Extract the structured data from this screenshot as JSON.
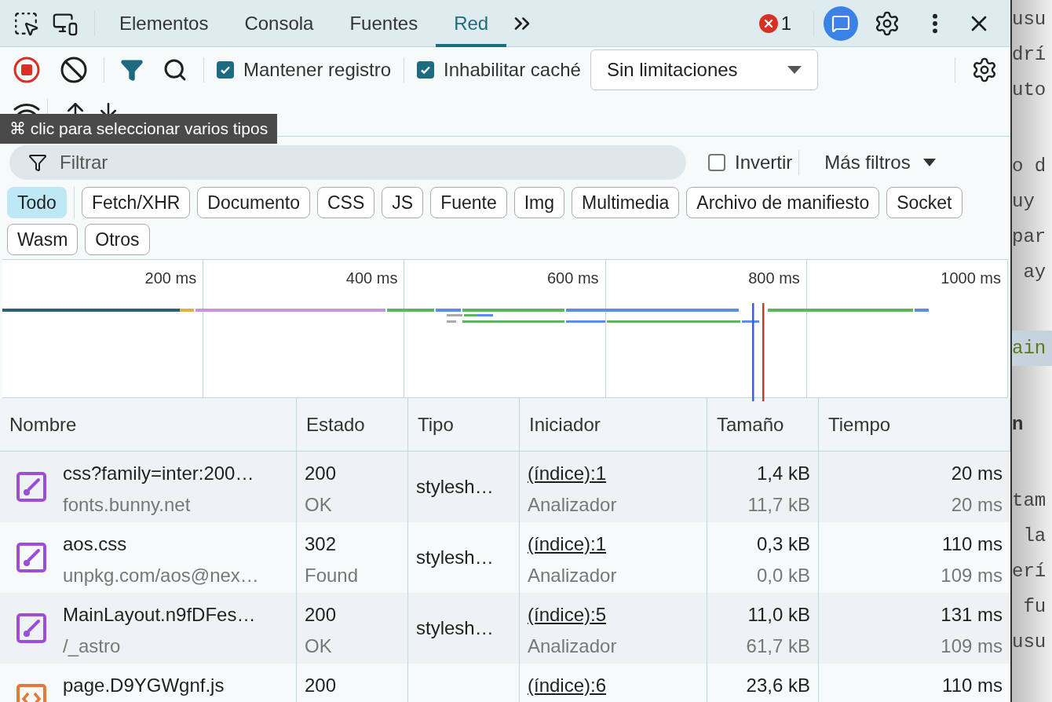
{
  "tabs": [
    {
      "label": "Elementos",
      "selected": false
    },
    {
      "label": "Consola",
      "selected": false
    },
    {
      "label": "Fuentes",
      "selected": false
    },
    {
      "label": "Red",
      "selected": true
    }
  ],
  "error_count": "1",
  "toolbar": {
    "recording": true,
    "checkboxes": [
      {
        "label": "Mantener registro",
        "checked": true
      },
      {
        "label": "Inhabilitar caché",
        "checked": true
      }
    ],
    "throttling": "Sin limitaciones"
  },
  "tooltip": "⌘ clic para seleccionar varios tipos",
  "filter": {
    "placeholder": "Filtrar",
    "invert": {
      "label": "Invertir",
      "checked": false
    },
    "more_filters": "Más filtros"
  },
  "type_filters": [
    {
      "label": "Todo",
      "selected": true
    },
    {
      "label": "Fetch/XHR",
      "selected": false
    },
    {
      "label": "Documento",
      "selected": false
    },
    {
      "label": "CSS",
      "selected": false
    },
    {
      "label": "JS",
      "selected": false
    },
    {
      "label": "Fuente",
      "selected": false
    },
    {
      "label": "Img",
      "selected": false
    },
    {
      "label": "Multimedia",
      "selected": false
    },
    {
      "label": "Archivo de manifiesto",
      "selected": false
    },
    {
      "label": "Socket",
      "selected": false
    },
    {
      "label": "Wasm",
      "selected": false
    },
    {
      "label": "Otros",
      "selected": false
    }
  ],
  "overview": {
    "ticks": [
      "200 ms",
      "400 ms",
      "600 ms",
      "800 ms",
      "1000 ms"
    ]
  },
  "table": {
    "columns": [
      "Nombre",
      "Estado",
      "Tipo",
      "Iniciador",
      "Tamaño",
      "Tiempo"
    ],
    "rows": [
      {
        "kind": "stylesheet",
        "name": "css?family=inter:200…",
        "sub": "fonts.bunny.net",
        "status": "200",
        "status_text": "OK",
        "type": "stylesh…",
        "initiator": "(índice):1",
        "initiator_sub": "Analizador",
        "size": "1,4 kB",
        "size_sub": "11,7 kB",
        "time": "20 ms",
        "time_sub": "20 ms"
      },
      {
        "kind": "stylesheet",
        "name": "aos.css",
        "sub": "unpkg.com/aos@nex…",
        "status": "302",
        "status_text": "Found",
        "type": "stylesh…",
        "initiator": "(índice):1",
        "initiator_sub": "Analizador",
        "size": "0,3 kB",
        "size_sub": "0,0 kB",
        "time": "110 ms",
        "time_sub": "109 ms"
      },
      {
        "kind": "stylesheet",
        "name": "MainLayout.n9fDFes…",
        "sub": "/_astro",
        "status": "200",
        "status_text": "OK",
        "type": "stylesh…",
        "initiator": "(índice):5",
        "initiator_sub": "Analizador",
        "size": "11,0 kB",
        "size_sub": "61,7 kB",
        "time": "131 ms",
        "time_sub": "109 ms"
      },
      {
        "kind": "script",
        "name": "page.D9YGWgnf.js",
        "status": "200",
        "initiator": "(índice):6",
        "size": "23,6 kB",
        "time": "110 ms"
      }
    ]
  },
  "page_behind": [
    {
      "kind": "text",
      "lines": [
        "usu",
        "drí",
        "uto"
      ]
    },
    {
      "kind": "text",
      "lines": [
        "o d",
        "uy",
        "par",
        " ay"
      ]
    },
    {
      "kind": "code",
      "lines": [
        "ain"
      ]
    },
    {
      "kind": "heading",
      "lines": [
        "n"
      ]
    },
    {
      "kind": "text",
      "lines": [
        "tam",
        " la",
        "erí",
        " fu",
        "usu"
      ]
    }
  ]
}
